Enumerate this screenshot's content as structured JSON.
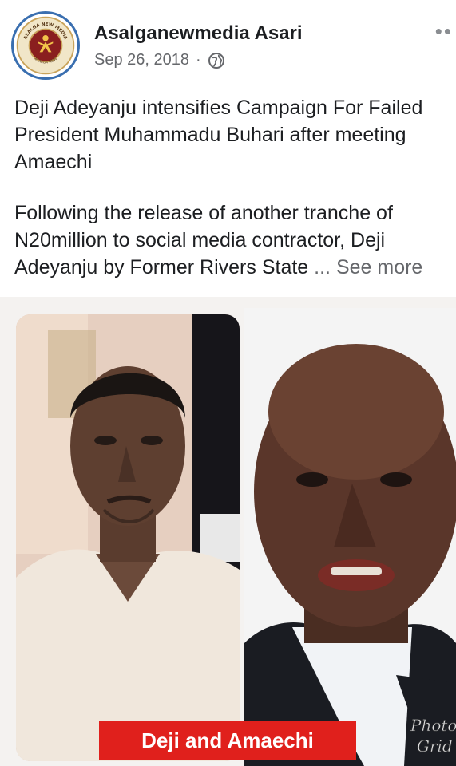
{
  "post": {
    "author": "Asalganewmedia Asari",
    "date": "Sep 26, 2018",
    "separator": "·",
    "privacy_icon": "globe-icon",
    "more_icon": "more-options-icon",
    "headline": "Deji Adeyanju intensifies Campaign For Failed President Muhammadu Buhari after meeting Amaechi",
    "body": "Following the release of another tranche of N20million to social media contractor, Deji Adeyanju by Former Rivers State ",
    "ellipsis": "...",
    "see_more": "See more"
  },
  "image": {
    "caption": "Deji and Amaechi",
    "caption_color": "#e0201c",
    "watermark_line1": "Photo",
    "watermark_line2": "Grid"
  },
  "avatar": {
    "logo_top_text": "ASALGA NEW MEDIA",
    "logo_bottom_text": "ASALGA NEW"
  }
}
